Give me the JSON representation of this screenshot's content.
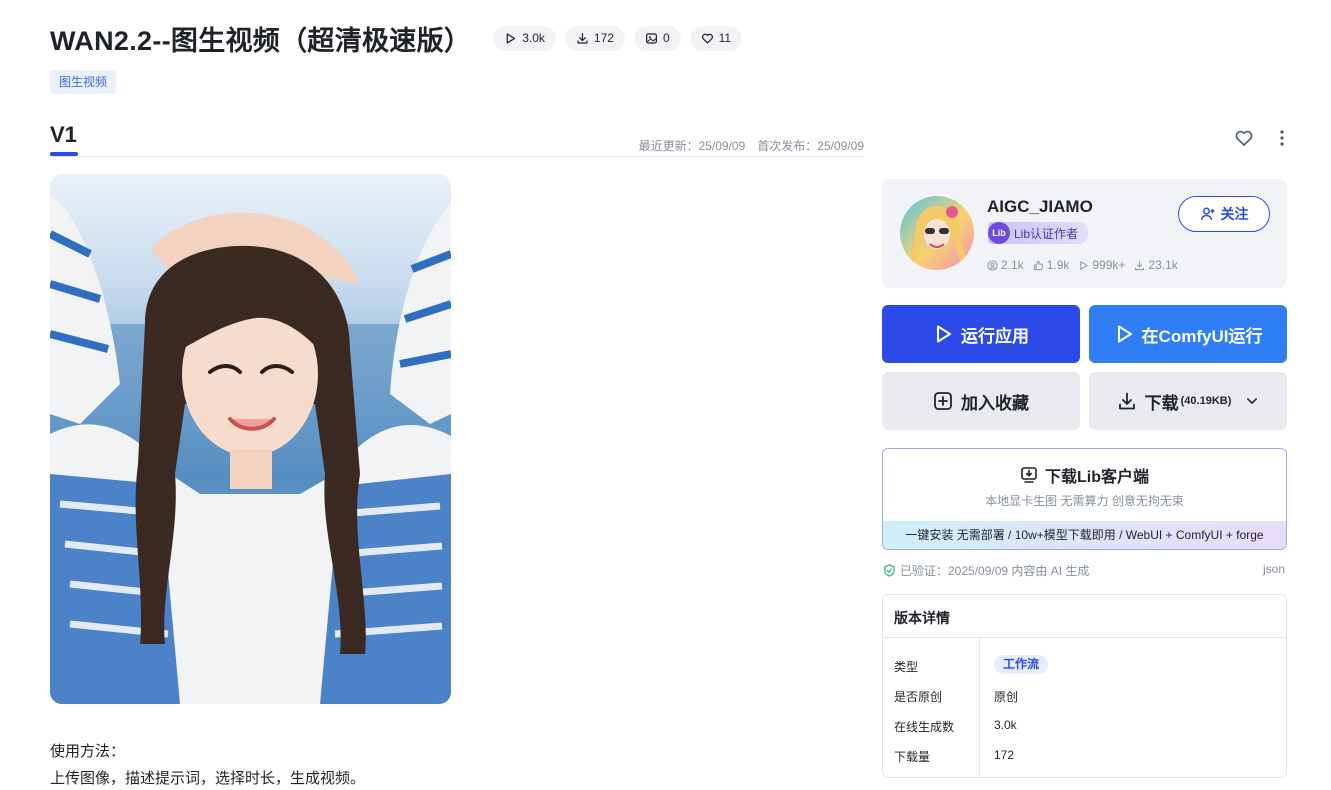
{
  "page": {
    "title": "WAN2.2--图生视频（超清极速版）"
  },
  "stats": [
    {
      "icon": "play-icon",
      "value": "3.0k"
    },
    {
      "icon": "download-icon",
      "value": "172"
    },
    {
      "icon": "image-icon",
      "value": "0"
    },
    {
      "icon": "heart-icon",
      "value": "11"
    }
  ],
  "tag": "图生视频",
  "version": {
    "tab": "V1",
    "updated": "最近更新：25/09/09",
    "published": "首次发布：25/09/09"
  },
  "usage": {
    "line1": "使用方法：",
    "line2": "上传图像，描述提示词，选择时长，生成视频。"
  },
  "author": {
    "name": "AIGC_JIAMO",
    "badge_logo": "Lib",
    "badge": "Lib认证作者",
    "followers": "2.1k",
    "likes": "1.9k",
    "runs": "999k+",
    "downloads": "23.1k",
    "follow_label": "关注"
  },
  "actions": {
    "run_app": "运行应用",
    "run_comfy": "在ComfyUI运行",
    "favorite": "加入收藏",
    "download": "下载",
    "download_size": "(40.19KB)"
  },
  "client": {
    "title": "下载Lib客户端",
    "subtitle": "本地显卡生图 无需算力 创意无拘无束",
    "strip": "一键安装 无需部署 / 10w+模型下载即用 / WebUI + ComfyUI + forge"
  },
  "verify": {
    "text": "已验证：2025/09/09 内容由 AI 生成",
    "json": "json"
  },
  "details": {
    "title": "版本详情",
    "rows": [
      {
        "key": "类型",
        "value": "工作流"
      },
      {
        "key": "是否原创",
        "value": "原创"
      },
      {
        "key": "在线生成数",
        "value": "3.0k"
      },
      {
        "key": "下载量",
        "value": "172"
      }
    ]
  },
  "colors": {
    "accent": "#2b4ae8",
    "accent2": "#2f7ef5",
    "tag_text": "#3f6bd8",
    "verify_green": "#2fb56f"
  }
}
